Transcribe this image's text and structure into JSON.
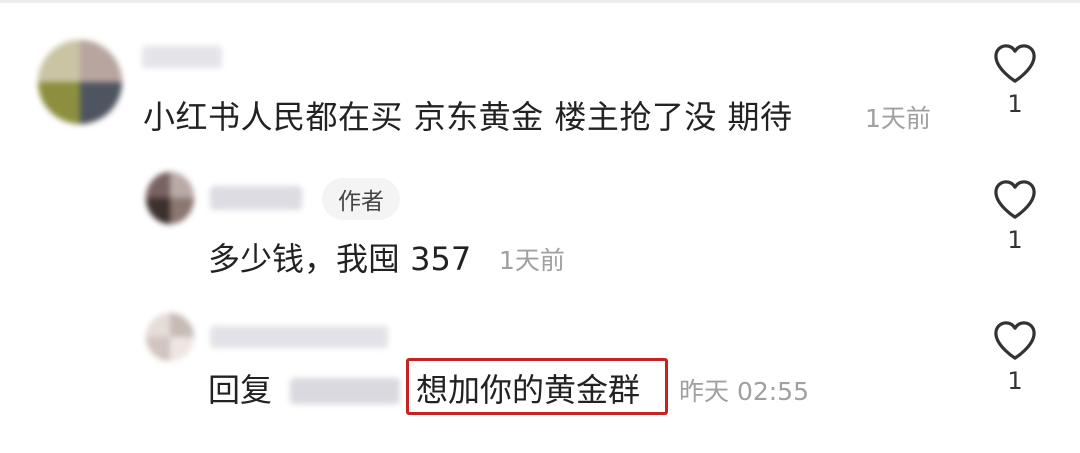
{
  "comments": {
    "main": {
      "text": "小红书人民都在买 京东黄金 楼主抢了没 期待",
      "time": "1天前",
      "likes": "1"
    },
    "author_reply": {
      "badge": "作者",
      "text": "多少钱，我囤 357",
      "time": "1天前",
      "likes": "1"
    },
    "reply": {
      "prefix": "回复",
      "highlighted_text": "想加你的黄金群",
      "time": "昨天 02:55",
      "likes": "1"
    }
  },
  "colors": {
    "highlight_border": "#c72222",
    "timestamp": "#a0a0a0",
    "text": "#222222"
  },
  "icons": {
    "like": "heart-outline-icon"
  }
}
